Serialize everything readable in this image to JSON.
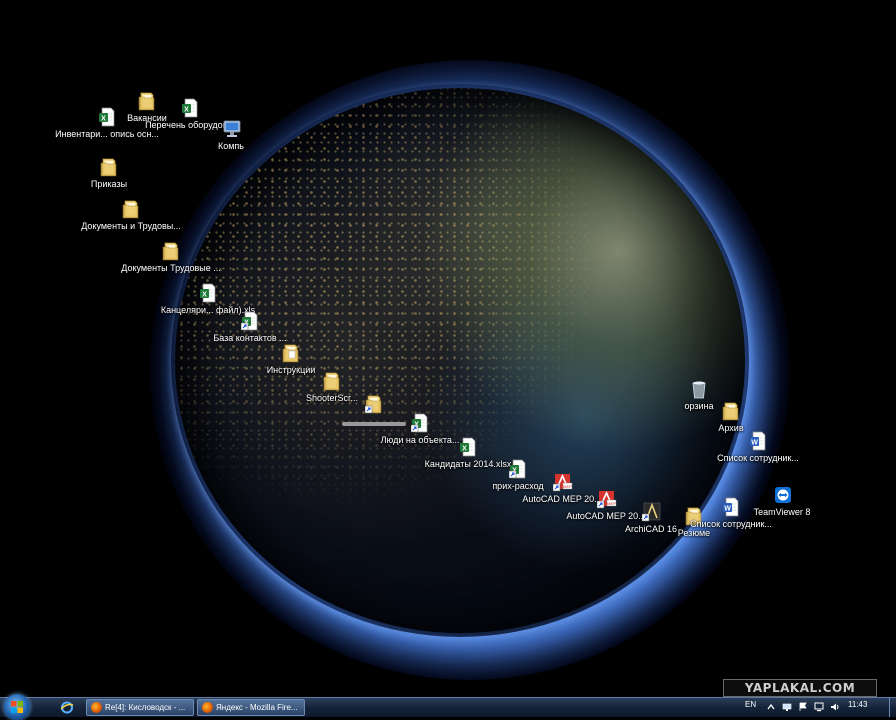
{
  "desktop": {
    "icons": [
      {
        "type": "excel",
        "label": "Инвентари... опись осн..."
      },
      {
        "type": "folder",
        "label": "Вакансии"
      },
      {
        "type": "excel",
        "label": "Перечень оборудов..."
      },
      {
        "type": "computer",
        "label": "Компь"
      },
      {
        "type": "folder",
        "label": "Приказы"
      },
      {
        "type": "folder",
        "label": "Документы и Трудовы..."
      },
      {
        "type": "folder",
        "label": "Документы Трудовые ..."
      },
      {
        "type": "excel",
        "label": "Канцеляри... файл).xls"
      },
      {
        "type": "excel-shortcut",
        "label": "База контактов ..."
      },
      {
        "type": "folder-doc",
        "label": "Инструкции"
      },
      {
        "type": "folder",
        "label": "ShooterScr..."
      },
      {
        "type": "folder-shortcut",
        "label": ""
      },
      {
        "type": "excel-shortcut",
        "label": "Люди на объекта..."
      },
      {
        "type": "excel",
        "label": "Кандидаты 2014.xlsx"
      },
      {
        "type": "excel-shortcut",
        "label": "прих-расход"
      },
      {
        "type": "autocad",
        "label": "AutoCAD MEP 20..."
      },
      {
        "type": "autocad",
        "label": "AutoCAD MEP 20..."
      },
      {
        "type": "archicad",
        "label": "ArchiCAD 16"
      },
      {
        "type": "folder",
        "label": "Резюме"
      },
      {
        "type": "recycle",
        "label": "орзина"
      },
      {
        "type": "folder",
        "label": "Архив"
      },
      {
        "type": "word",
        "label": "Список сотрудник..."
      },
      {
        "type": "word",
        "label": "Список сотрудник..."
      },
      {
        "type": "teamviewer",
        "label": "TeamViewer 8"
      }
    ]
  },
  "taskbar": {
    "tasks": [
      {
        "label": "Re[4]: Кисловодск - ..."
      },
      {
        "label": "Яндекс - Mozilla Fire..."
      }
    ],
    "language": "EN",
    "clock": "11:43"
  },
  "watermark": "YAPLAKAL.COM"
}
